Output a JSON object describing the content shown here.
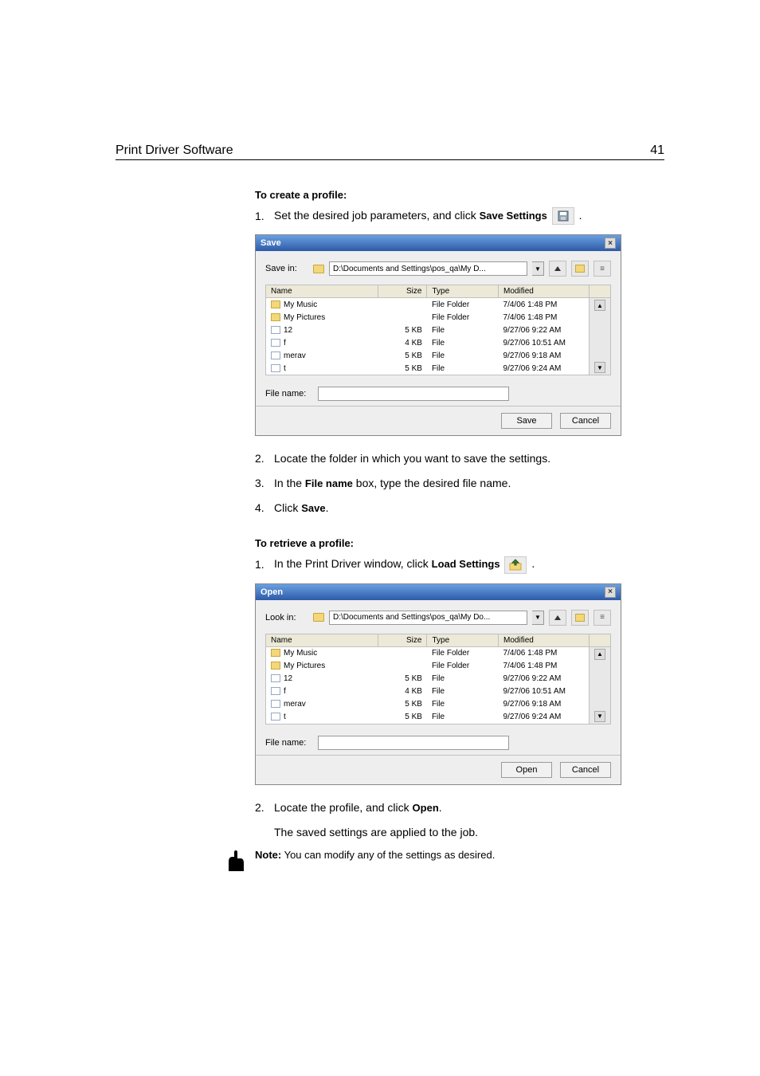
{
  "header": {
    "left": "Print Driver Software",
    "right": "41"
  },
  "sec1": {
    "heading": "To create a profile:",
    "step1_num": "1.",
    "step1_a": "Set the desired job parameters, and click ",
    "step1_b": "Save Settings",
    "step1_c": " .",
    "step2_num": "2.",
    "step2": "Locate the folder in which you want to save the settings.",
    "step3_num": "3.",
    "step3_a": "In the ",
    "step3_b": "File name",
    "step3_c": " box, type the desired file name.",
    "step4_num": "4.",
    "step4_a": "Click ",
    "step4_b": "Save",
    "step4_c": "."
  },
  "sec2": {
    "heading": "To retrieve a profile:",
    "step1_num": "1.",
    "step1_a": "In the Print Driver window, click ",
    "step1_b": "Load Settings",
    "step1_c": " .",
    "step2_num": "2.",
    "step2_a": "Locate the profile, and click ",
    "step2_b": "Open",
    "step2_c": ".",
    "step2_extra": "The saved settings are applied to the job.",
    "note_label": "Note:",
    "note_text": "  You can modify any of the settings as desired."
  },
  "saveDlg": {
    "title": "Save",
    "close": "×",
    "savein_label": "Save in:",
    "path": "D:\\Documents and Settings\\pos_qa\\My D...",
    "cols": {
      "name": "Name",
      "size": "Size",
      "type": "Type",
      "modified": "Modified"
    },
    "rows": [
      {
        "icon": "folder",
        "name": "My Music",
        "size": "",
        "type": "File Folder",
        "mod": "7/4/06 1:48 PM"
      },
      {
        "icon": "folder",
        "name": "My Pictures",
        "size": "",
        "type": "File Folder",
        "mod": "7/4/06 1:48 PM"
      },
      {
        "icon": "file",
        "name": "12",
        "size": "5 KB",
        "type": "File",
        "mod": "9/27/06 9:22 AM"
      },
      {
        "icon": "file",
        "name": "f",
        "size": "4 KB",
        "type": "File",
        "mod": "9/27/06 10:51 AM"
      },
      {
        "icon": "file",
        "name": "merav",
        "size": "5 KB",
        "type": "File",
        "mod": "9/27/06 9:18 AM"
      },
      {
        "icon": "file",
        "name": "t",
        "size": "5 KB",
        "type": "File",
        "mod": "9/27/06 9:24 AM"
      }
    ],
    "filename_label": "File name:",
    "btn_primary": "Save",
    "btn_cancel": "Cancel"
  },
  "openDlg": {
    "title": "Open",
    "close": "×",
    "lookin_label": "Look in:",
    "path": "D:\\Documents and Settings\\pos_qa\\My Do...",
    "cols": {
      "name": "Name",
      "size": "Size",
      "type": "Type",
      "modified": "Modified"
    },
    "rows": [
      {
        "icon": "folder",
        "name": "My Music",
        "size": "",
        "type": "File Folder",
        "mod": "7/4/06 1:48 PM"
      },
      {
        "icon": "folder",
        "name": "My Pictures",
        "size": "",
        "type": "File Folder",
        "mod": "7/4/06 1:48 PM"
      },
      {
        "icon": "file",
        "name": "12",
        "size": "5 KB",
        "type": "File",
        "mod": "9/27/06 9:22 AM"
      },
      {
        "icon": "file",
        "name": "f",
        "size": "4 KB",
        "type": "File",
        "mod": "9/27/06 10:51 AM"
      },
      {
        "icon": "file",
        "name": "merav",
        "size": "5 KB",
        "type": "File",
        "mod": "9/27/06 9:18 AM"
      },
      {
        "icon": "file",
        "name": "t",
        "size": "5 KB",
        "type": "File",
        "mod": "9/27/06 9:24 AM"
      }
    ],
    "filename_label": "File name:",
    "btn_primary": "Open",
    "btn_cancel": "Cancel"
  }
}
